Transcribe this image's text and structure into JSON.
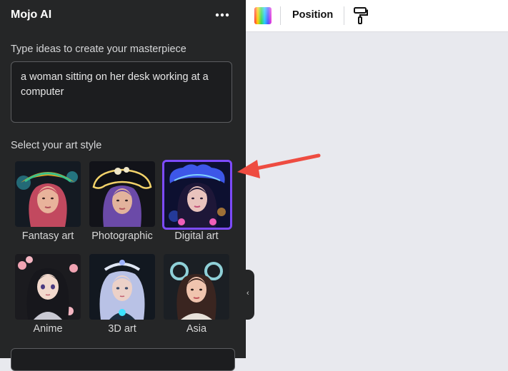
{
  "panel": {
    "title": "Mojo AI",
    "more_icon": "more-horizontal-icon",
    "prompt_label": "Type ideas to create your masterpiece",
    "prompt_value": "a woman sitting on her desk working at a computer",
    "style_label": "Select your art style",
    "styles": [
      {
        "name": "Fantasy art",
        "selected": false
      },
      {
        "name": "Photographic",
        "selected": false
      },
      {
        "name": "Digital art",
        "selected": true
      },
      {
        "name": "Anime",
        "selected": false
      },
      {
        "name": "3D art",
        "selected": false
      },
      {
        "name": "Asia",
        "selected": false
      }
    ],
    "selected_color": "#7d4bff"
  },
  "toolbar": {
    "color_icon": "color-picker-icon",
    "position_label": "Position",
    "paint_icon": "paint-roller-icon"
  },
  "collapse_icon": "chevron-left-icon",
  "annotation": {
    "icon": "arrow-icon",
    "color": "#ee4c41"
  }
}
